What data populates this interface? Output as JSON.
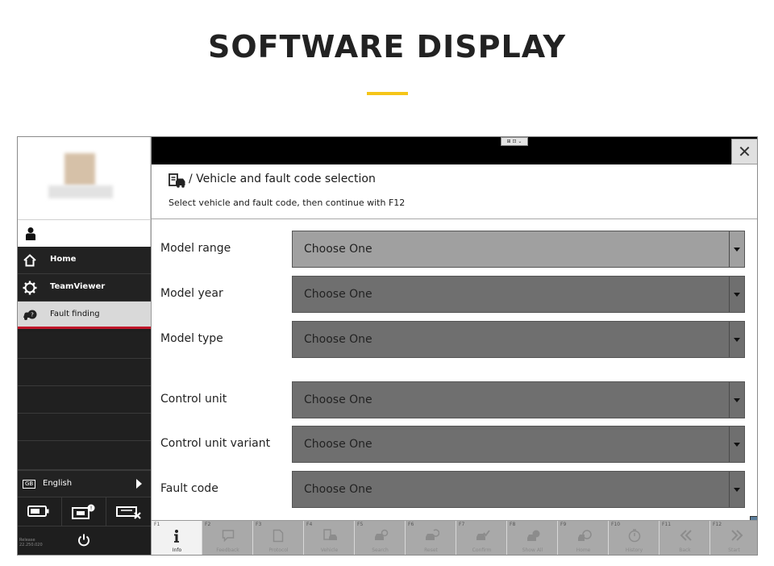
{
  "banner": {
    "title": "SOFTWARE DISPLAY",
    "accent_color": "#f5c518"
  },
  "window": {
    "view_toggle_label": "⊞ ⊡ ⌄",
    "close_icon": "close-x-icon"
  },
  "sidebar": {
    "user_icon": "user-icon",
    "nav": [
      {
        "label": "Home",
        "icon": "home-icon"
      },
      {
        "label": "TeamViewer",
        "icon": "gear-icon"
      },
      {
        "label": "Fault finding",
        "icon": "car-fault-icon"
      }
    ],
    "active_index": 2,
    "language": {
      "badge": "GB",
      "label": "English"
    },
    "release_text": "Release\n22.250.020",
    "active_color": "#c0162a"
  },
  "header": {
    "title": "/ Vehicle and fault code selection",
    "subtitle": "Select vehicle and fault code, then continue with F12"
  },
  "form": {
    "fields": [
      {
        "label": "Model range",
        "value": "Choose One"
      },
      {
        "label": "Model year",
        "value": "Choose One"
      },
      {
        "label": "Model type",
        "value": "Choose One"
      },
      {
        "label": "Control unit",
        "value": "Choose One"
      },
      {
        "label": "Control unit variant",
        "value": "Choose One"
      },
      {
        "label": "Fault code",
        "value": "Choose One"
      }
    ]
  },
  "function_keys": [
    {
      "key": "F1",
      "label": "Info"
    },
    {
      "key": "F2",
      "label": "Feedback"
    },
    {
      "key": "F3",
      "label": "Protocol"
    },
    {
      "key": "F4",
      "label": "Vehicle"
    },
    {
      "key": "F5",
      "label": "Search"
    },
    {
      "key": "F6",
      "label": "Reset"
    },
    {
      "key": "F7",
      "label": "Confirm"
    },
    {
      "key": "F8",
      "label": "Show All"
    },
    {
      "key": "F9",
      "label": "Home"
    },
    {
      "key": "F10",
      "label": "History"
    },
    {
      "key": "F11",
      "label": "Back"
    },
    {
      "key": "F12",
      "label": "Start"
    }
  ]
}
